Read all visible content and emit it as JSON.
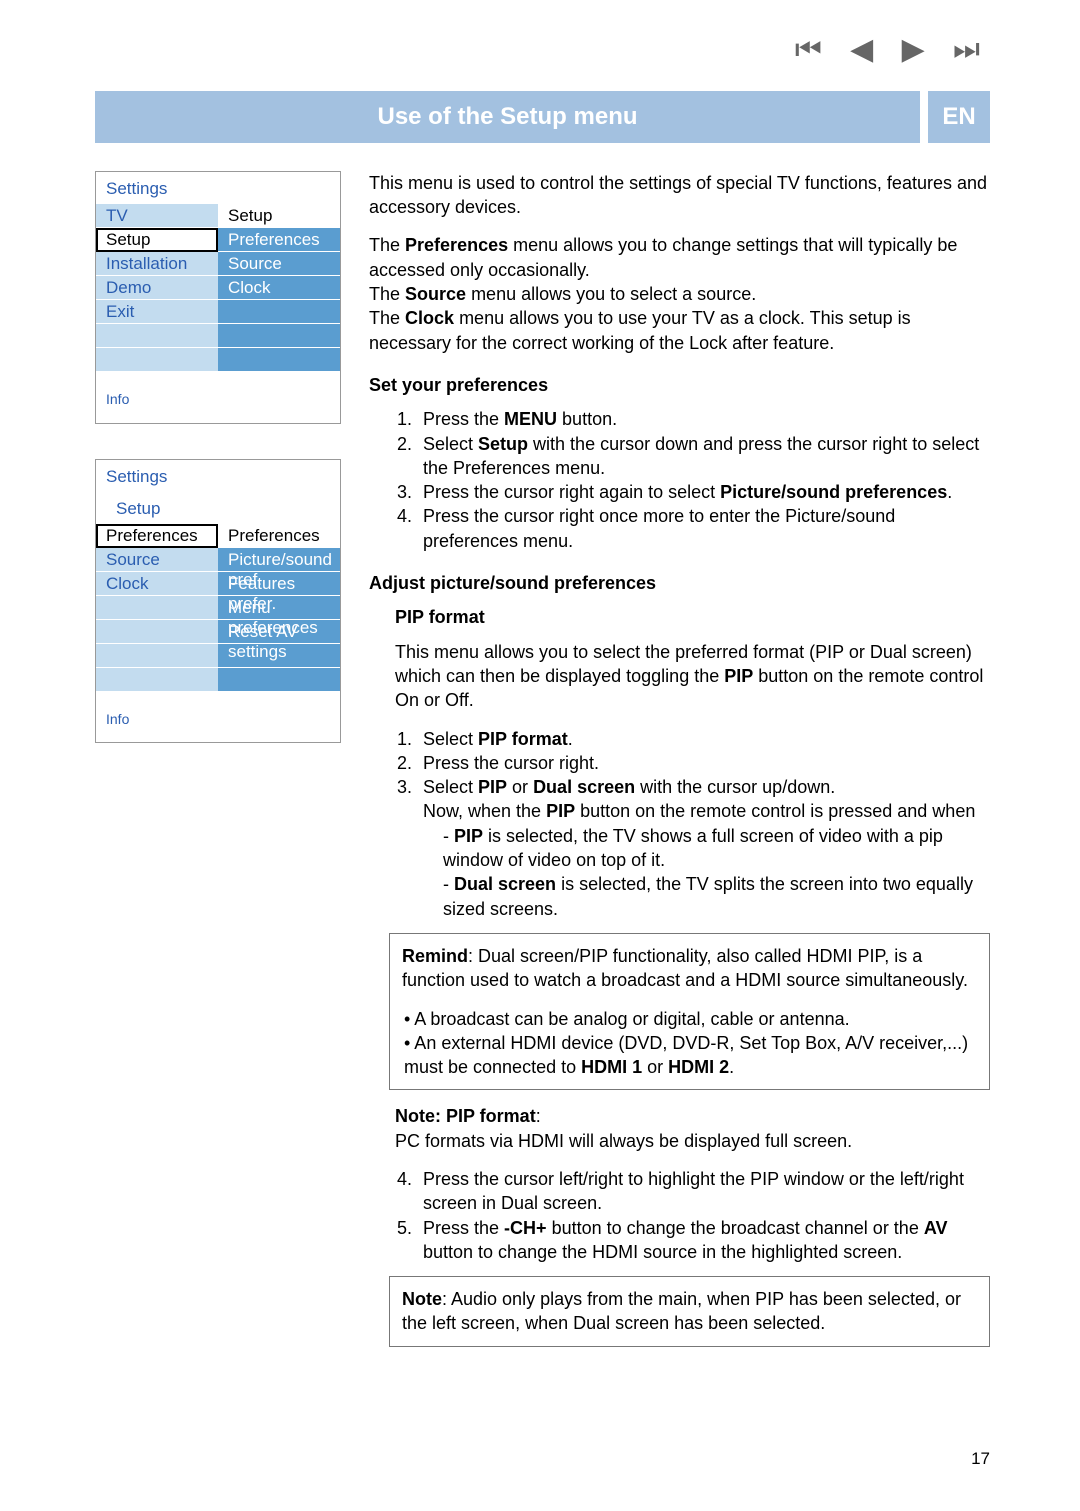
{
  "nav_icons": {
    "first": "⏮",
    "prev": "◀",
    "next": "▶",
    "last": "⏭"
  },
  "title": "Use of the Setup menu",
  "lang": "EN",
  "menu1": {
    "header": "Settings",
    "left": [
      "TV",
      "Setup",
      "Installation",
      "Demo",
      "Exit"
    ],
    "right_head": "Setup",
    "right": [
      "Preferences",
      "Source",
      "Clock"
    ],
    "info": "Info"
  },
  "menu2": {
    "header": "Settings",
    "subheader": "Setup",
    "left": [
      "Preferences",
      "Source",
      "Clock"
    ],
    "right_head": "Preferences",
    "right": [
      "Picture/sound pref.",
      "Features prefer.",
      "Menu preferences",
      "Reset AV settings"
    ],
    "info": "Info"
  },
  "body": {
    "intro": "This menu is used to control the settings of special TV functions, features and accessory devices.",
    "prefs_para": {
      "p1a": "The ",
      "p1b": "Preferences",
      "p1c": " menu allows you to change settings that will typically be accessed only occasionally.",
      "p2a": "The ",
      "p2b": "Source",
      "p2c": " menu allows you to select a source.",
      "p3a": "The ",
      "p3b": "Clock",
      "p3c": " menu allows you to use your TV as a clock. This setup is necessary for the correct working of the Lock after feature."
    },
    "set_heading": "Set your preferences",
    "steps1": {
      "s1a": "Press the ",
      "s1b": "MENU",
      "s1c": " button.",
      "s2a": "Select ",
      "s2b": "Setup",
      "s2c": " with the cursor down and press the cursor right to select the Preferences menu.",
      "s3a": "Press the cursor right again to select ",
      "s3b": "Picture/sound preferences",
      "s3c": ".",
      "s4": "Press the cursor right once more to enter the Picture/sound preferences menu."
    },
    "adjust_heading": "Adjust picture/sound preferences",
    "pip_heading": "PIP format",
    "pip_intro_a": "This menu allows you to select the preferred format (PIP or Dual screen) which can then be displayed toggling the ",
    "pip_intro_b": "PIP",
    "pip_intro_c": " button on the remote control On or Off.",
    "steps2": {
      "s1a": "Select ",
      "s1b": "PIP format",
      "s1c": ".",
      "s2": "Press the cursor right.",
      "s3a": "Select ",
      "s3b": "PIP",
      "s3c": " or ",
      "s3d": "Dual screen",
      "s3e": " with the cursor up/down.",
      "s3f_a": "Now, when the ",
      "s3f_b": "PIP",
      "s3f_c": " button on the remote control is pressed and when",
      "s3_sub1_a": "PIP",
      "s3_sub1_b": " is selected, the TV shows a full screen of video with a pip window of video on top of it.",
      "s3_sub2_a": "Dual screen",
      "s3_sub2_b": " is selected, the TV splits the screen into two equally sized screens."
    },
    "remind": {
      "r1_a": "Remind",
      "r1_b": ": Dual screen/PIP functionality, also called HDMI PIP, is a function used to watch a broadcast and a HDMI source simultaneously.",
      "r2": "• A broadcast can be analog or digital, cable or antenna.",
      "r3_a": "• An external HDMI device (DVD, DVD-R, Set Top Box, A/V receiver,...) must be connected to ",
      "r3_b": "HDMI 1",
      "r3_c": " or ",
      "r3_d": "HDMI 2",
      "r3_e": "."
    },
    "note1_a": "Note: PIP format",
    "note1_b": ":",
    "note1_c": "PC formats via HDMI will always be displayed full screen.",
    "steps3": {
      "s4": "Press the cursor left/right to highlight the PIP window or the left/right screen in Dual screen.",
      "s5_a": "Press the ",
      "s5_b": "-CH+",
      "s5_c": " button to change the broadcast channel or the ",
      "s5_d": "AV",
      "s5_e": " button to change the HDMI source in the highlighted screen."
    },
    "note2_a": "Note",
    "note2_b": ": Audio only plays from the main, when PIP has been selected, or the left screen, when Dual screen has been selected."
  },
  "page_number": "17"
}
